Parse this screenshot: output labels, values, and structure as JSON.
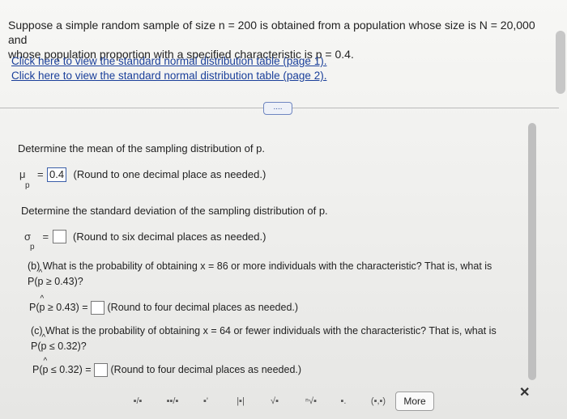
{
  "question": {
    "line1": "Suppose a simple random sample of size n = 200 is obtained from a population whose size is N = 20,000 and",
    "line2": "whose population proportion with a specified characteristic is p = 0.4."
  },
  "links": {
    "table1": "Click here to view the standard normal distribution table (page 1).",
    "table2": "Click here to view the standard normal distribution table (page 2)."
  },
  "expand_button": "....",
  "mean": {
    "prompt": "Determine the mean of the sampling distribution of p.",
    "symbol": "μ",
    "subscript": "p",
    "equals": "=",
    "answer": "0.4",
    "hint": "(Round to one decimal place as needed.)"
  },
  "stdev": {
    "prompt": "Determine the standard deviation of the sampling distribution of p.",
    "symbol": "σ",
    "subscript": "p",
    "equals": "=",
    "answer": "",
    "hint": "(Round to six decimal places as needed.)"
  },
  "part_b": {
    "line1": "(b) What is the probability of obtaining x = 86 or more individuals with the characteristic? That is, what is",
    "line2_pre": "P(",
    "line2_p": "p",
    "line2_post": " ≥ 0.43)?",
    "ans_pre": "P(",
    "ans_p": "p",
    "ans_post": " ≥ 0.43) =",
    "answer": "",
    "hint": "(Round to four decimal places as needed.)"
  },
  "part_c": {
    "line1": "(c) What is the probability of obtaining x = 64 or fewer individuals with the characteristic? That is, what is",
    "line2_pre": "P(",
    "line2_p": "p",
    "line2_post": " ≤ 0.32)?",
    "ans_pre": "P(",
    "ans_p": "p",
    "ans_post": " ≤ 0.32) =",
    "answer": "",
    "hint": "(Round to four decimal places as needed.)"
  },
  "toolbar": {
    "fraction": "▪/▪",
    "mixed_number": "▪▪/▪",
    "exponent": "▪'",
    "absolute_value": "|▪|",
    "sqrt": "√▪",
    "nth_root": "ⁿ√▪",
    "decimal": "▪.",
    "interval": "(▪,▪)",
    "more": "More",
    "close": "✕"
  }
}
